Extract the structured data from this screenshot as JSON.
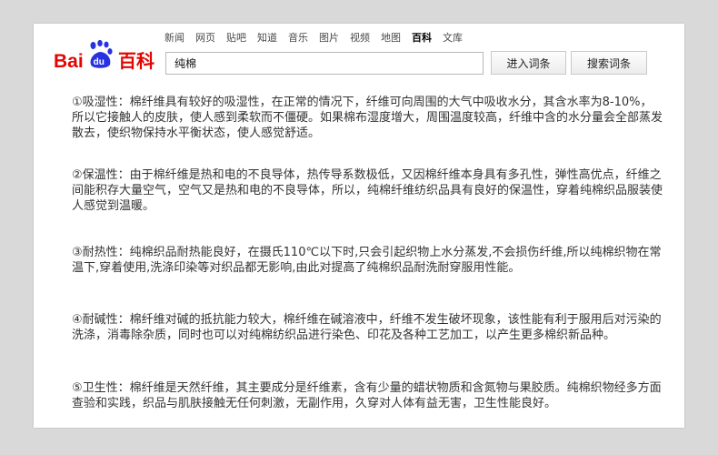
{
  "nav": {
    "items": [
      "新闻",
      "网页",
      "贴吧",
      "知道",
      "音乐",
      "图片",
      "视频",
      "地图",
      "百科",
      "文库"
    ],
    "active": "百科"
  },
  "logo": {
    "text_bai": "Bai",
    "text_du": "du",
    "text_baike": "百科",
    "colors": {
      "red": "#e10601",
      "blue": "#2932e1"
    }
  },
  "search": {
    "value": "纯棉",
    "enter_label": "进入词条",
    "search_label": "搜索词条"
  },
  "content": {
    "paragraphs": [
      "①吸湿性：棉纤维具有较好的吸湿性，在正常的情况下，纤维可向周围的大气中吸收水分，其含水率为8-10%，所以它接触人的皮肤，使人感到柔软而不僵硬。如果棉布湿度增大，周围温度较高，纤维中含的水分量会全部蒸发散去，使织物保持水平衡状态，使人感觉舒适。",
      "②保温性：由于棉纤维是热和电的不良导体，热传导系数极低，又因棉纤维本身具有多孔性，弹性高优点，纤维之间能积存大量空气，空气又是热和电的不良导体，所以，纯棉纤维纺织品具有良好的保温性，穿着纯棉织品服装使人感觉到温暖。",
      "③耐热性：纯棉织品耐热能良好，在摄氏110℃以下时,只会引起织物上水分蒸发,不会损伤纤维,所以纯棉织物在常温下,穿着使用,洗涤印染等对织品都无影响,由此对提高了纯棉织品耐洗耐穿服用性能。",
      "④耐碱性：棉纤维对碱的抵抗能力较大，棉纤维在碱溶液中，纤维不发生破坏现象，该性能有利于服用后对污染的洗涤，消毒除杂质，同时也可以对纯棉纺织品进行染色、印花及各种工艺加工，以产生更多棉织新品种。",
      "⑤卫生性：棉纤维是天然纤维，其主要成分是纤维素，含有少量的蜡状物质和含氮物与果胶质。纯棉织物经多方面查验和实践，织品与肌肤接触无任何刺激，无副作用，久穿对人体有益无害，卫生性能良好。"
    ]
  }
}
